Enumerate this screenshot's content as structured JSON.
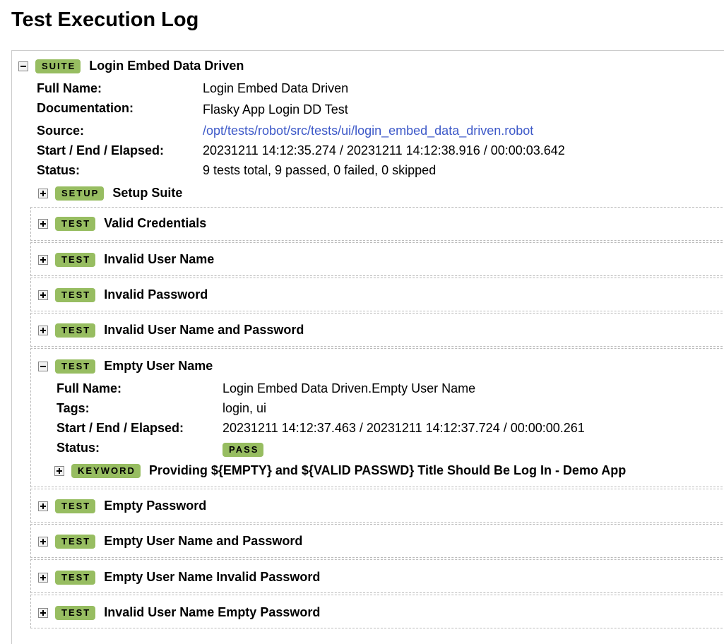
{
  "page": {
    "title": "Test Execution Log"
  },
  "suite": {
    "label": "SUITE",
    "name": "Login Embed Data Driven",
    "fields": [
      {
        "key": "Full Name:",
        "value": "Login Embed Data Driven"
      },
      {
        "key": "Documentation:",
        "value": "Flasky App Login DD Test"
      },
      {
        "key": "Source:",
        "value": "/opt/tests/robot/src/tests/ui/login_embed_data_driven.robot"
      },
      {
        "key": "Start / End / Elapsed:",
        "value": "20231211 14:12:35.274 / 20231211 14:12:38.916 / 00:00:03.642"
      },
      {
        "key": "Status:",
        "value": "9 tests total, 9 passed, 0 failed, 0 skipped"
      }
    ],
    "setup": {
      "label": "SETUP",
      "name": "Setup Suite"
    },
    "tests": [
      {
        "label": "TEST",
        "name": "Valid Credentials"
      },
      {
        "label": "TEST",
        "name": "Invalid User Name"
      },
      {
        "label": "TEST",
        "name": "Invalid Password"
      },
      {
        "label": "TEST",
        "name": "Invalid User Name and Password"
      },
      {
        "label": "TEST",
        "name": "Empty User Name",
        "expanded": true,
        "fields": [
          {
            "key": "Full Name:",
            "value": "Login Embed Data Driven.Empty User Name"
          },
          {
            "key": "Tags:",
            "value": "login, ui"
          },
          {
            "key": "Start / End / Elapsed:",
            "value": "20231211 14:12:37.463 / 20231211 14:12:37.724 / 00:00:00.261"
          },
          {
            "key": "Status:",
            "value": "PASS"
          }
        ],
        "keyword": {
          "label": "KEYWORD",
          "name": "Providing ${EMPTY} and ${VALID PASSWD} Title Should Be Log In - Demo App"
        }
      },
      {
        "label": "TEST",
        "name": "Empty Password"
      },
      {
        "label": "TEST",
        "name": "Empty User Name and Password"
      },
      {
        "label": "TEST",
        "name": "Empty User Name Invalid Password"
      },
      {
        "label": "TEST",
        "name": "Invalid User Name Empty Password"
      }
    ]
  },
  "colors": {
    "label_bg": "#97bd61",
    "link": "#3c58c8"
  }
}
